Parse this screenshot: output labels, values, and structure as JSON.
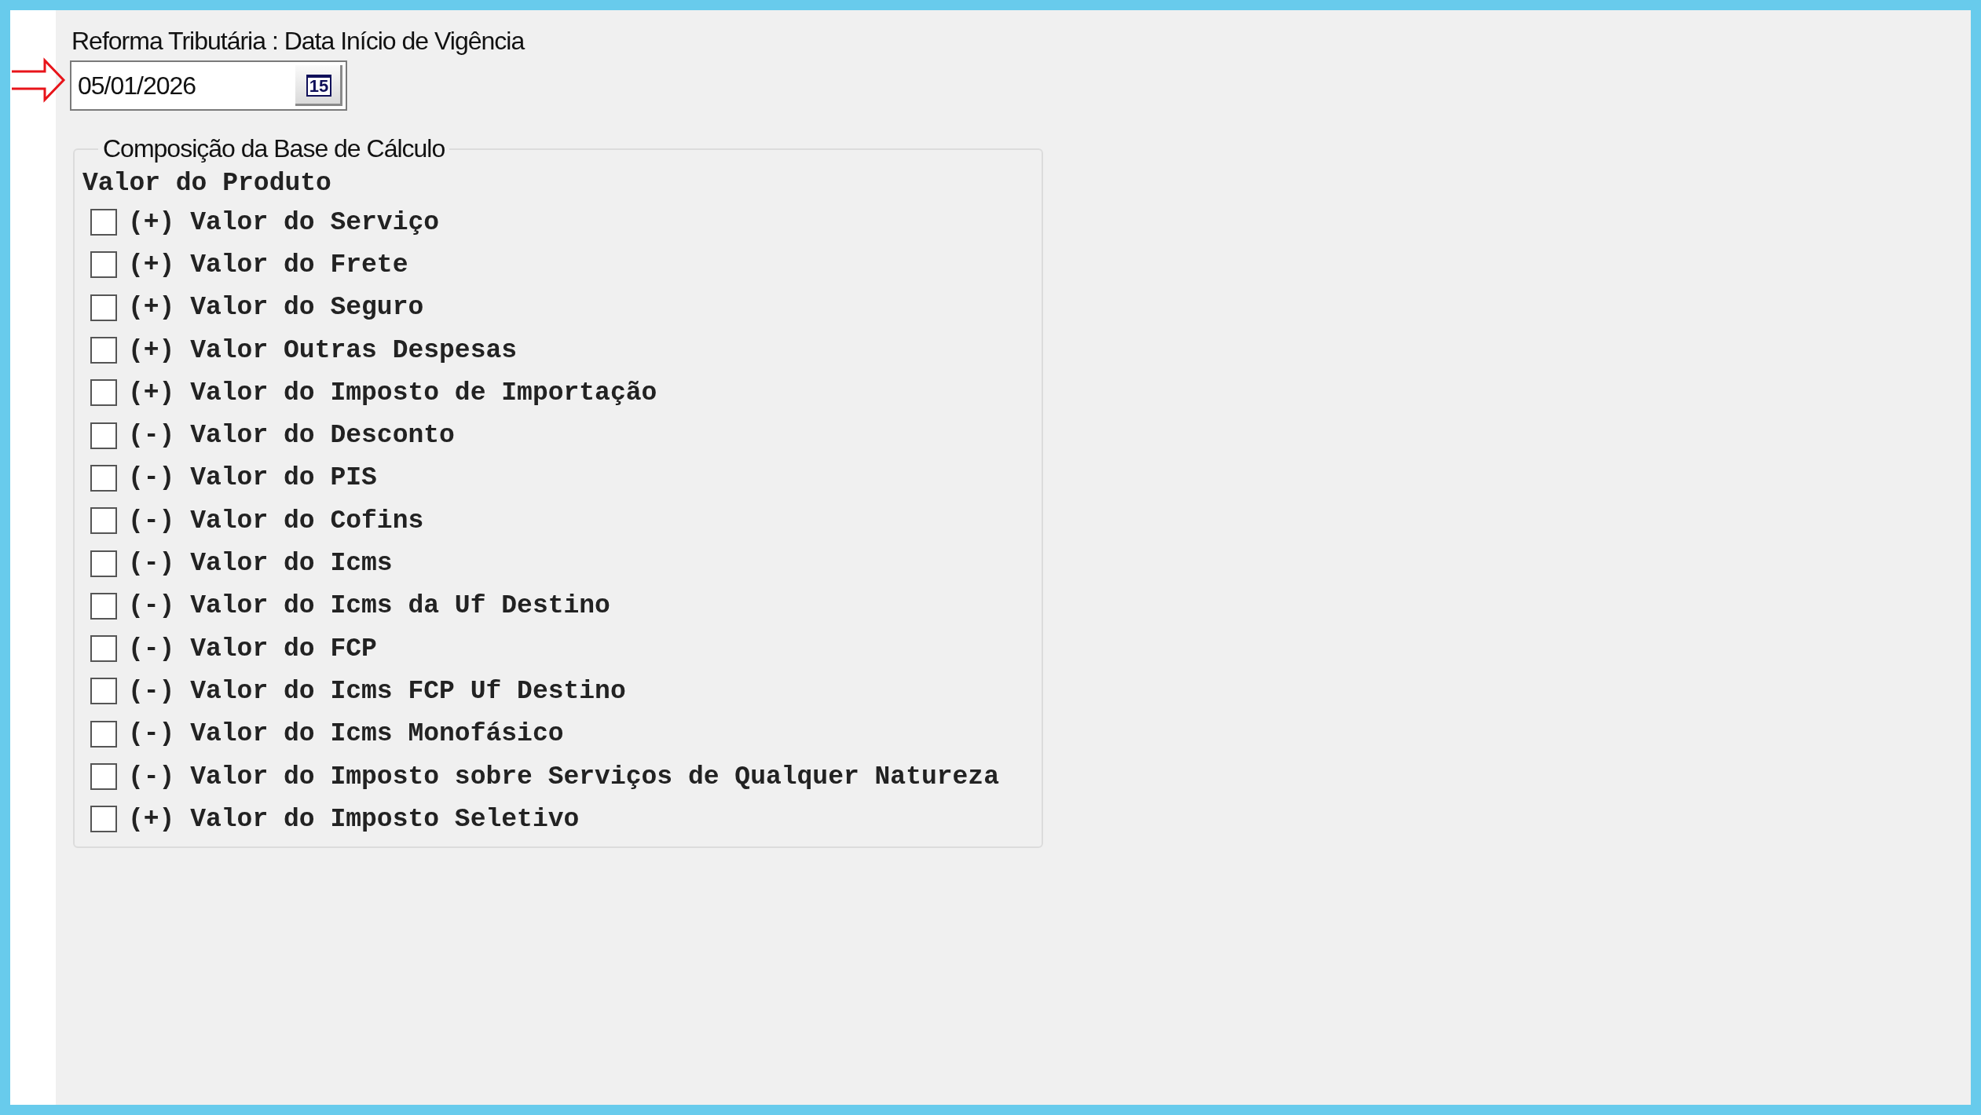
{
  "field_label": "Reforma Tributária :  Data Início de Vigência",
  "date_field": {
    "value": "05/01/2026",
    "calendar_button": "15"
  },
  "group": {
    "title": "Composição da Base de Cálculo",
    "base_label": "Valor do Produto",
    "items": [
      {
        "label": "(+) Valor do Serviço",
        "checked": false
      },
      {
        "label": "(+) Valor do Frete",
        "checked": false
      },
      {
        "label": "(+) Valor do Seguro",
        "checked": false
      },
      {
        "label": "(+) Valor Outras Despesas",
        "checked": false
      },
      {
        "label": "(+) Valor do Imposto de Importação",
        "checked": false
      },
      {
        "label": "(-) Valor do Desconto",
        "checked": false
      },
      {
        "label": "(-) Valor do PIS",
        "checked": false
      },
      {
        "label": "(-) Valor do Cofins",
        "checked": false
      },
      {
        "label": "(-) Valor do Icms",
        "checked": false
      },
      {
        "label": "(-) Valor do Icms da Uf Destino",
        "checked": false
      },
      {
        "label": "(-) Valor do FCP",
        "checked": false
      },
      {
        "label": "(-) Valor do Icms FCP Uf Destino",
        "checked": false
      },
      {
        "label": "(-) Valor do Icms Monofásico",
        "checked": false
      },
      {
        "label": "(-) Valor do Imposto sobre Serviços de Qualquer Natureza",
        "checked": false
      },
      {
        "label": "(+) Valor do Imposto Seletivo",
        "checked": false
      }
    ]
  }
}
